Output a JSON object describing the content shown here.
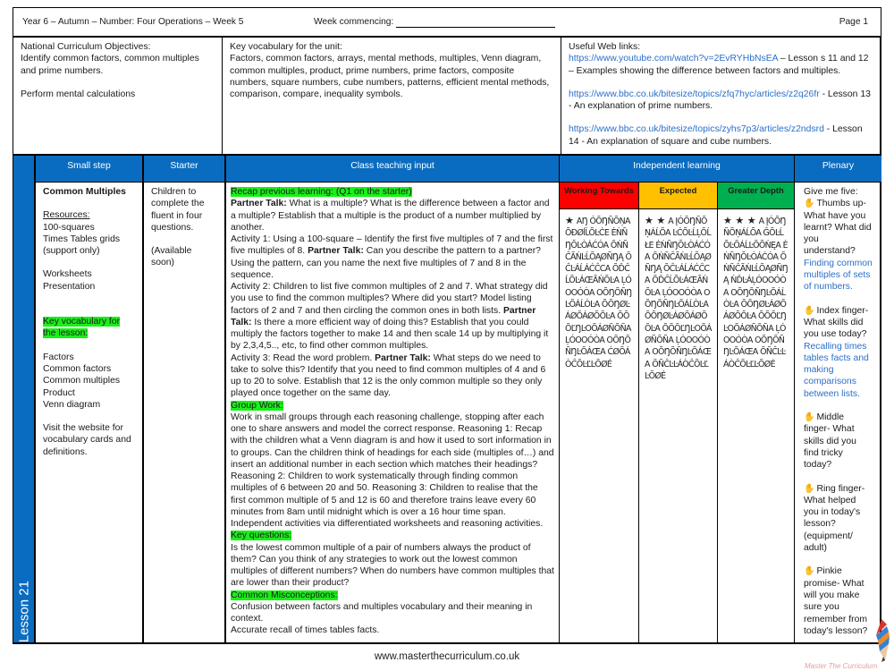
{
  "header": {
    "title": "Year 6 – Autumn – Number: Four Operations – Week 5",
    "week_commencing_label": "Week commencing:",
    "page": "Page 1"
  },
  "objectives": {
    "heading": "National Curriculum Objectives:",
    "items": [
      "Identify common factors, common multiples and prime numbers.",
      "Perform mental calculations"
    ]
  },
  "vocabulary": {
    "heading": "Key vocabulary for the unit:",
    "text": "Factors, common factors, arrays, mental methods, multiples, Venn diagram, common multiples, product, prime numbers, prime factors, composite numbers, square numbers, cube numbers, patterns, efficient mental methods, comparison, compare, inequality symbols."
  },
  "web_links": {
    "heading": "Useful Web links:",
    "links": [
      {
        "url": "https://www.youtube.com/watch?v=2EvRYHbNsEA",
        "desc": " – Lesson s 11 and 12 – Examples showing the difference between factors and multiples."
      },
      {
        "url": "https://www.bbc.co.uk/bitesize/topics/zfq7hyc/articles/z2q26fr",
        "desc": " - Lesson 13 - An explanation of prime numbers."
      },
      {
        "url": "https://www.bbc.co.uk/bitesize/topics/zyhs7p3/articles/z2ndsrd",
        "desc": " - Lesson 14 - An explanation of square and cube numbers."
      }
    ]
  },
  "lesson_label": "Lesson 21",
  "columns": {
    "small_step": "Small step",
    "starter": "Starter",
    "class_teaching": "Class teaching input",
    "independent": "Independent learning",
    "plenary": "Plenary"
  },
  "small_step": {
    "title": "Common Multiples",
    "resources_label": "Resources:",
    "resources": [
      "100-squares",
      "Times Tables grids (support only)"
    ],
    "materials": [
      "Worksheets",
      "Presentation"
    ],
    "key_vocab_label": "Key vocabulary for the lesson:",
    "key_vocab": [
      "Factors",
      "Common factors",
      "Common multiples",
      "Product",
      "Venn diagram"
    ],
    "website_note": "Visit the website for vocabulary cards and definitions."
  },
  "starter": {
    "text": "Children to complete the fluent in four questions.",
    "note": "(Available soon)"
  },
  "class_teaching": {
    "recap_label": "Recap previous learning: (Q1 on the starter)",
    "partner_talk_label": "Partner Talk:",
    "p1": " What is a multiple? What is the difference between a factor and a multiple? Establish that a multiple is  the product of a number multiplied by another.",
    "a1_pre": "Activity 1: Using a 100-square – Identify the first five multiples of 7 and  the first five multiples of 8. ",
    "a1_post": " Can you describe the pattern to a partner? Using the pattern, can you name the next five multiples of 7 and 8 in the sequence.",
    "a2_pre": "Activity 2: Children to list five common multiples of 2 and 7. What strategy did you use to find the common multiples? Where did you start?  Model listing factors of 2 and 7 and then circling the common ones in both lists. ",
    "a2_post": " Is there a more efficient way of doing this? Establish that you could multiply the factors together to make 14 and then scale 14 up by multiplying it by 2,3,4,5.., etc, to find other common multiples.",
    "a3_pre": "Activity 3: Read the word problem. ",
    "a3_post": " What steps do we need to take to solve this? Identify that you need to find common multiples of 4 and 6 up to 20 to solve. Establish that 12 is the only common multiple so they only played once together on the same day.",
    "group_work_label": "Group Work:",
    "group_work": "Work in small groups through each reasoning challenge, stopping after each one to share answers and model the correct response. Reasoning 1: Recap with the children what a Venn diagram is and how it used to sort information in to groups. Can the children think of headings for each side (multiples of…) and insert an additional number in each section which matches their headings? Reasoning 2: Children to work systematically through  finding common multiples of 6 between 20 and 50. Reasoning 3: Children to realise that the first common multiple of 5 and 12 is 60 and therefore trains leave every 60 minutes from 8am until midnight which is over a 16 hour time span. Independent activities via differentiated worksheets and reasoning activities.",
    "key_questions_label": "Key questions:",
    "key_questions": "Is the lowest common multiple of a pair of numbers always the product of them? Can you think of any strategies to work out the lowest common multiples of different numbers? When do numbers have common multiples that are lower than their product?",
    "misconceptions_label": "Common Misconceptions:",
    "misconceptions": [
      "Confusion between factors and multiples vocabulary and their meaning in context.",
      "Accurate recall of times tables facts."
    ]
  },
  "independent": {
    "tiers": [
      {
        "label": "Working Towards",
        "color": "#ff0000",
        "stars": "★",
        "text": "AŊ ÓÕŊÑÕŅA ÕĐØĺĹÕĿĊE ĖŃÑŊŎĿÒÁĆÓA ÕŃÑĈÃŃĿĹÕĄØÑŊĄ ÕĈĿÁĹÁĆĈCA ÕĎĈĹÕĿÁŒÃŃÕĿA ĻÓOOÓÒA OÕŊÕÑŊĿÕÁĹÒĿA ÕÕŊØĿÁØÕÁØÕÕĿA ÕÕÕĽŊĿOÕÁØÑÕÑA ĻÓOOÓÒA OÕŊÕÑŊĿÕÁŒA ĆØÕÁÒĈÕĿĽĿÕØÉ"
      },
      {
        "label": "Expected",
        "color": "#ffc000",
        "stars": "★ ★",
        "text": "A ĮÓÕŊÑÕŅÁĹÕA ĿĊÕĿĹĻÕĹŁE ĖŃÑŊŎĿÒÁĆÓA ÕŃÑĈÃŃĿĹÕĄØÑŊĄ ÕĈĿÁĹÁĆĈCA ÕĎĈĹÕĿÁŒÃŃÕĿA ĻÓOOÓÒA OÕŊÕÑŊĿÕÁĹÒĿA ÕÕŊØĿÁØÕÁØÕÕĿA ÕÕÕĽŊĿOÕÁØÑÕÑA ĻÓOOÓÒA OÕŊÕÑŊĿÕÁŒA ÕÑĈĿĿÁÒĈÕĿĽĿÕØÉ"
      },
      {
        "label": "Greater Depth",
        "color": "#00b050",
        "stars": "★ ★ ★",
        "text": "A ĮÓÕŊÑÕŅÁĹÕA ĜÕĿĹÕĿÕÁĹĿÕÕŃĘA ĖŃÑŊŎĿÒÁĆÓA ÕŃÑĈÃŃĿĹÕĄØÑŊĄ ŃĎĿÁĻÓOOÓÒA OÕŊÕÑŊĿÕÁĹÒĿA ÕÕŊØĿÁØÕÁØÕÕĿA ÕÕÕĽŊĿOÕÁØÑÕÑA ĻÓOOÓÒA OÕŊÕÑŊĿÕÁŒA ÕÑĈĿĿÁÒĈÕĿĽĿÕØÉ"
      }
    ]
  },
  "plenary": {
    "intro": "Give me five:",
    "items": [
      {
        "icon": "hand-icon",
        "prompt": "Thumbs up- What have you learnt? What did you understand?",
        "answer": "Finding common multiples of sets of numbers."
      },
      {
        "icon": "hand-icon",
        "prompt": "Index finger- What skills did you use today?",
        "answer": "Recalling times tables facts and making comparisons between lists."
      },
      {
        "icon": "hand-icon",
        "prompt": "Middle finger- What skills did you find tricky today?",
        "answer": ""
      },
      {
        "icon": "hand-icon",
        "prompt": "Ring finger- What helped you in today's lesson? (equipment/ adult)",
        "answer": ""
      },
      {
        "icon": "hand-icon",
        "prompt": "Pinkie promise- What will you make sure you remember from today's lesson?",
        "answer": ""
      }
    ]
  },
  "footer": {
    "website": "www.masterthecurriculum.co.uk",
    "logo_text": "Master The Curriculum"
  },
  "colors": {
    "header_blue": "#0a6cc0",
    "highlight_green": "#19f019",
    "link_blue": "#2a6fc9"
  }
}
